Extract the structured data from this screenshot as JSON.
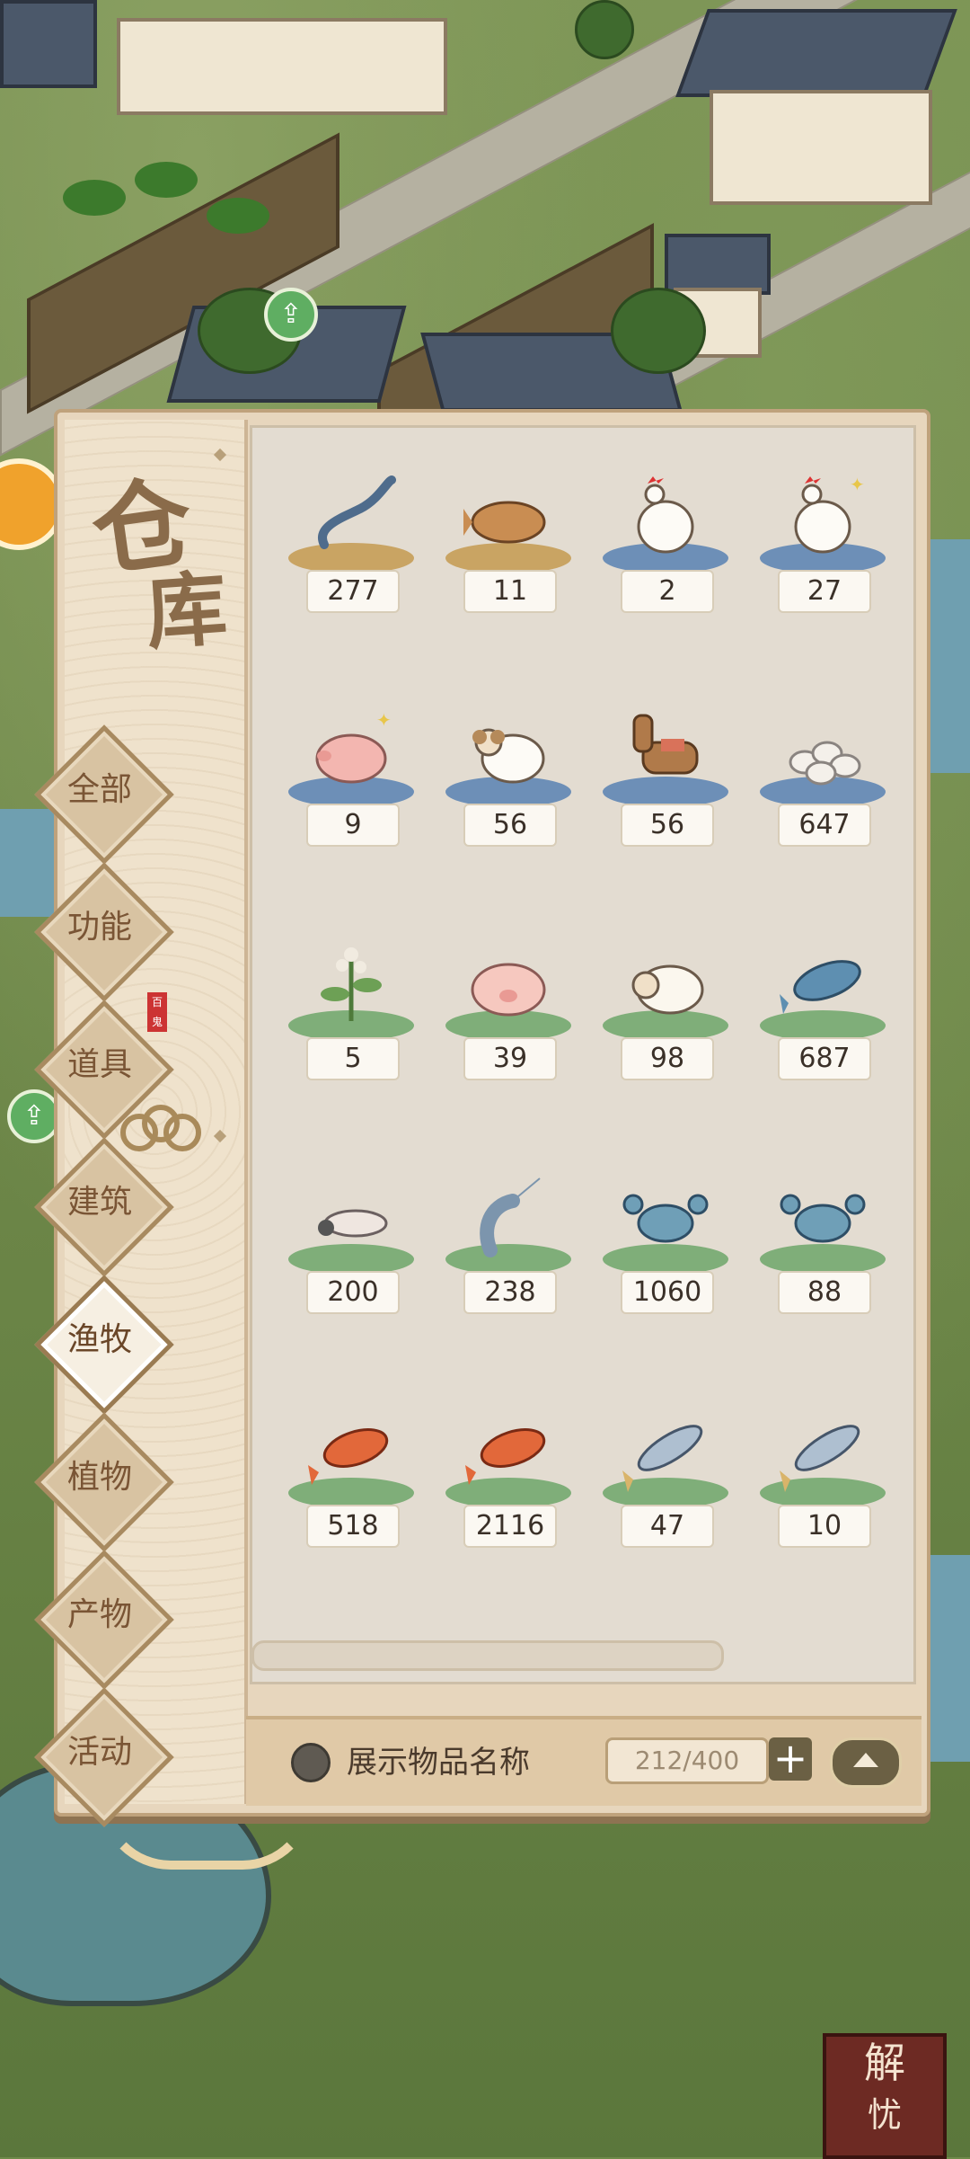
{
  "panel": {
    "title_line1": "仓",
    "title_line2": "库",
    "seal_text": "百鬼",
    "categories": [
      {
        "label": "全部",
        "active": false
      },
      {
        "label": "功能",
        "active": false
      },
      {
        "label": "道具",
        "active": false
      },
      {
        "label": "建筑",
        "active": false
      },
      {
        "label": "渔牧",
        "active": true
      },
      {
        "label": "植物",
        "active": false
      },
      {
        "label": "产物",
        "active": false
      },
      {
        "label": "活动",
        "active": false
      }
    ]
  },
  "items": [
    {
      "icon": "eel-icon",
      "count": "277",
      "platform": "fish"
    },
    {
      "icon": "grouper-fish-icon",
      "count": "11",
      "platform": "fish"
    },
    {
      "icon": "rooster-icon",
      "count": "2",
      "platform": "bird"
    },
    {
      "icon": "sparkly-rooster-icon",
      "count": "27",
      "platform": "bird"
    },
    {
      "icon": "sparkly-pig-icon",
      "count": "9",
      "platform": "bird"
    },
    {
      "icon": "ram-icon",
      "count": "56",
      "platform": "bird"
    },
    {
      "icon": "horse-icon",
      "count": "56",
      "platform": "bird"
    },
    {
      "icon": "eggs-icon",
      "count": "647",
      "platform": "bird"
    },
    {
      "icon": "flower-plant-icon",
      "count": "5",
      "platform": "green"
    },
    {
      "icon": "pig-icon",
      "count": "39",
      "platform": "green"
    },
    {
      "icon": "sheep-icon",
      "count": "98",
      "platform": "green"
    },
    {
      "icon": "blue-fish-icon",
      "count": "687",
      "platform": "green"
    },
    {
      "icon": "silkworm-icon",
      "count": "200",
      "platform": "green"
    },
    {
      "icon": "shrimp-icon",
      "count": "238",
      "platform": "green"
    },
    {
      "icon": "blue-crab-icon",
      "count": "1060",
      "platform": "green"
    },
    {
      "icon": "blue-crab-icon",
      "count": "88",
      "platform": "green"
    },
    {
      "icon": "red-carp-icon",
      "count": "518",
      "platform": "green"
    },
    {
      "icon": "red-carp-icon",
      "count": "2116",
      "platform": "green"
    },
    {
      "icon": "silver-fish-icon",
      "count": "47",
      "platform": "green"
    },
    {
      "icon": "silver-fish-icon",
      "count": "10",
      "platform": "green"
    }
  ],
  "footer": {
    "toggle_label": "展示物品名称",
    "capacity": "212/400",
    "plus_symbol": "+"
  },
  "corner_stamp": {
    "line1": "解",
    "line2": "忧"
  },
  "colors": {
    "panel_bg": "#e7d6bd",
    "accent_brown": "#8a6b4a",
    "platform_fish": "#c9a463",
    "platform_bird": "#6d8fb7",
    "platform_green": "#7fae79"
  }
}
